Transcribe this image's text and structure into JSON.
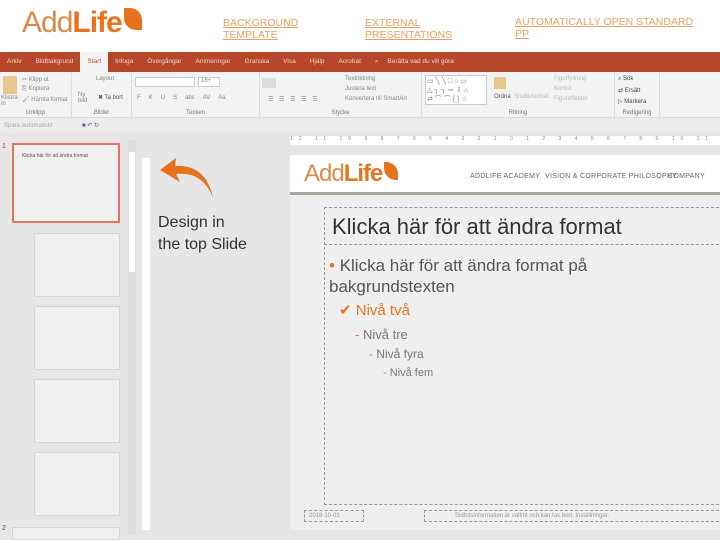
{
  "header": {
    "logo_add": "Add",
    "logo_life": "Life",
    "links": [
      "BACKGROUND TEMPLATE",
      "EXTERNAL PRESENTATIONS",
      "AUTOMATICALLY OPEN STANDARD PP"
    ]
  },
  "ribbon": {
    "tabs": [
      "Arkiv",
      "Bildbakgrund",
      "Start",
      "Infoga",
      "Övergångar",
      "Animeringar",
      "Granska",
      "Visa",
      "Hjälp",
      "Acrobat"
    ],
    "tell_me": "Berätta vad du vill göra",
    "clipboard": {
      "paste": "Klistra in",
      "cut": "Klipp ut",
      "copy": "Kopiera",
      "format_painter": "Hämta format",
      "label": "Urklipp"
    },
    "slides": {
      "layout": "Layout",
      "new_slide": "Ny bild",
      "delete": "Ta bort",
      "label": "Bilder"
    },
    "font": {
      "size": "18+",
      "label": "Tecken",
      "buttons": [
        "F",
        "K",
        "U",
        "S",
        "abc",
        "AV",
        "Aa"
      ]
    },
    "paragraph": {
      "label": "Stycke",
      "text_direction": "Textriktning",
      "align_text": "Justera text",
      "smartart": "Konvertera till SmartArt"
    },
    "drawing": {
      "arrange": "Ordna",
      "quick_styles": "Snabbformat",
      "fill": "Figurfyllning",
      "outline": "Kontur",
      "effects": "Figureffekter",
      "label": "Ritning"
    },
    "editing": {
      "find": "Sök",
      "replace": "Ersätt",
      "select": "Markera",
      "label": "Redigering"
    }
  },
  "qat": {
    "autosave": "Spara automatiskt"
  },
  "thumbnails": {
    "slide1": "1",
    "slide2": "2"
  },
  "ruler": "12 11 10 9 8 7 6 5 4 3 2 1 0 1 2 3 4 5 6 7 8 9 10 11",
  "annotation": {
    "line1": "Design in",
    "line2": "the top Slide"
  },
  "slide": {
    "logo_add": "Add",
    "logo_life": "Life",
    "nav": [
      "ADDLIFE ACADEMY",
      "VISION & CORPORATE PHILOSOPHY",
      "COMPANY"
    ],
    "title": "Klicka här för att ändra format",
    "level1": "Klicka här för att ändra format på bakgrundstexten",
    "level2": "Nivå två",
    "level3": "Nivå tre",
    "level4": "Nivå fyra",
    "level5": "Nivå fem",
    "date": "2018-10-01",
    "footer": "Sidfotsinformation är valfritt och kan tas bort. Inställningar."
  },
  "colors": {
    "accent": "#e8731e",
    "ribbon": "#b7472a"
  }
}
